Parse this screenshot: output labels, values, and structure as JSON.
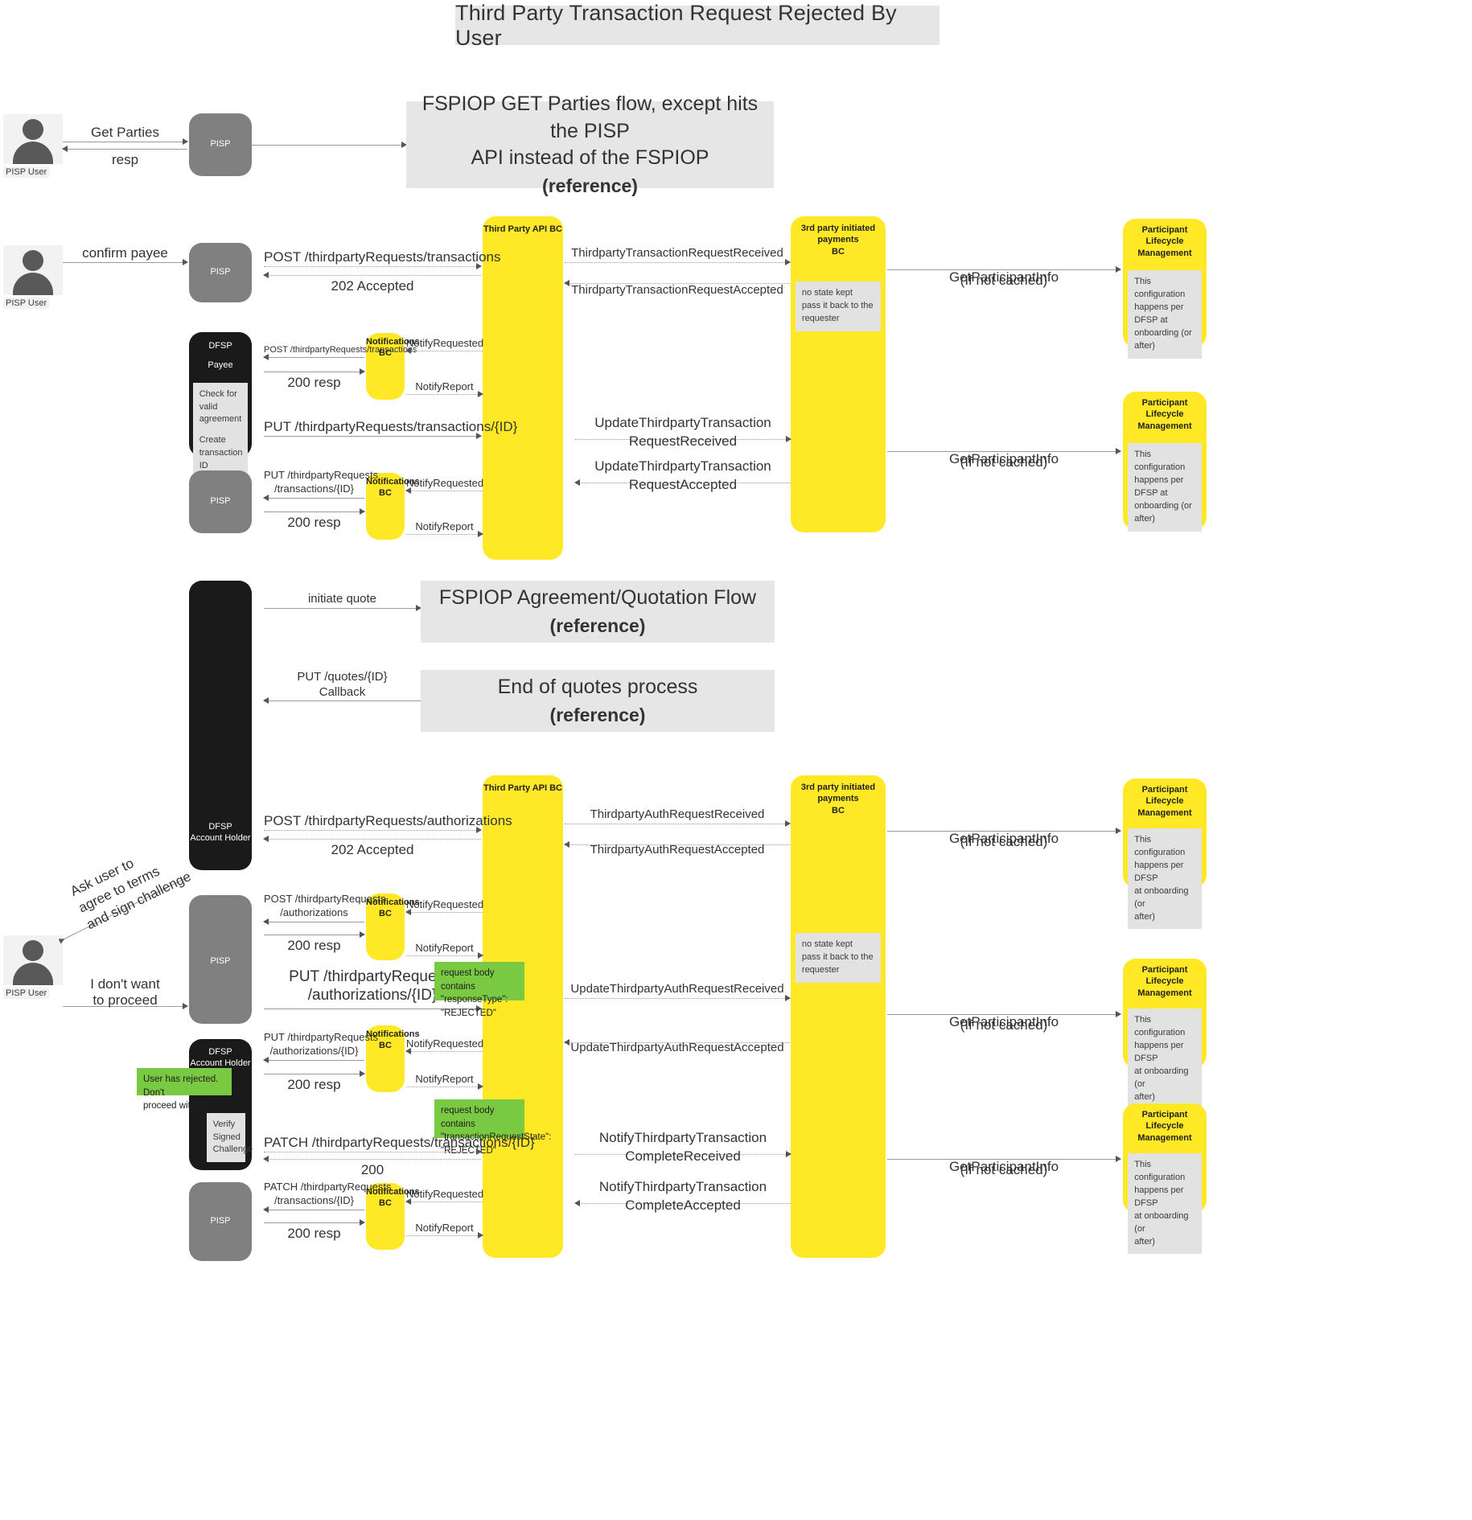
{
  "title": "Third Party Transaction Request Rejected By User",
  "actors": {
    "pisp_user": "PISP User",
    "pisp": "PISP",
    "dfsp_payee_line1": "DFSP",
    "dfsp_payee_line2": "Payee",
    "dfsp_account_holder_line1": "DFSP",
    "dfsp_account_holder_line2": "Account Holder",
    "third_party_api_bc": "Third Party API BC",
    "third_party_payments_bc": "3rd party initiated payments\nBC",
    "third_party_payments_bc_l1": "3rd party initiated payments",
    "third_party_payments_bc_l2": "BC",
    "notifications_bc_l1": "Notifications",
    "notifications_bc_l2": "BC",
    "participant_lifecycle_l1": "Participant Lifecycle",
    "participant_lifecycle_l2": "Management"
  },
  "reference_boxes": {
    "get_parties": {
      "main_line1": "FSPIOP GET Parties flow, except hits the PISP",
      "main_line2": "API instead of the FSPIOP",
      "sub": "(reference)"
    },
    "quotation": {
      "main_line1": "FSPIOP Agreement/Quotation Flow",
      "main_line2": "",
      "sub": "(reference)"
    },
    "end_of_quotes": {
      "main_line1": "End of quotes process",
      "main_line2": "",
      "sub": "(reference)"
    }
  },
  "notes": {
    "no_state_kept": "no state kept\npass it back to the\nrequester",
    "no_state_kept_l1": "no state kept",
    "no_state_kept_l2": "pass it back to the",
    "no_state_kept_l3": "requester",
    "config_onboarding_l1": "This configuration",
    "config_onboarding_l2": "happens per DFSP at",
    "config_onboarding_l3": "onboarding (or after)",
    "config_onboarding_b_l1": "This configuration",
    "config_onboarding_b_l2": "happens per DFSP",
    "config_onboarding_b_l3": "at onboarding (or",
    "config_onboarding_b_l4": "after)",
    "check_valid_agreement_l1": "Check for valid",
    "check_valid_agreement_l2": "agreement",
    "create_transaction_id_l1": "Create",
    "create_transaction_id_l2": "transaction ID",
    "verify_signed_challenge_l1": "Verify",
    "verify_signed_challenge_l2": "Signed",
    "verify_signed_challenge_l3": "Challenge",
    "green_response_type_l1": "request body contains",
    "green_response_type_l2": "\"responseType\":",
    "green_response_type_l3": "\"REJECTED\"",
    "green_tx_state_l1": "request body contains",
    "green_tx_state_l2": "\"transactionRequestState\":",
    "green_tx_state_l3": "\"REJECTED\"",
    "green_user_rejected_l1": "User has rejected. Don't",
    "green_user_rejected_l2": "proceed with tx."
  },
  "messages": {
    "get_parties": "Get Parties",
    "resp": "resp",
    "confirm_payee": "confirm payee",
    "post_tpr_transactions": "POST /thirdpartyRequests/transactions",
    "accepted_202": "202 Accepted",
    "tp_tx_req_received": "ThirdpartyTransactionRequestReceived",
    "tp_tx_req_accepted": "ThirdpartyTransactionRequestAccepted",
    "get_participant_info": "GetParticipantInfo",
    "if_not_cached": "(If not cached)",
    "post_tpr_transactions_small": "POST /thirdpartyRequests/transactions",
    "notify_requested": "NotifyRequested",
    "notify_report": "NotifyReport",
    "resp_200": "200 resp",
    "put_tpr_transactions_id": "PUT /thirdpartyRequests/transactions/{ID}",
    "put_tpr_transactions_l1": "PUT /thirdpartyRequests",
    "put_tpr_transactions_l2": "/transactions/{ID}",
    "update_tp_tx_req_received_l1": "UpdateThirdpartyTransaction",
    "update_tp_tx_req_received_l2": "RequestReceived",
    "update_tp_tx_req_accepted_l1": "UpdateThirdpartyTransaction",
    "update_tp_tx_req_accepted_l2": "RequestAccepted",
    "initiate_quote": "initiate quote",
    "put_quotes_l1": "PUT /quotes/{ID}",
    "put_quotes_l2": "Callback",
    "post_tpr_authorizations": "POST /thirdpartyRequests/authorizations",
    "tp_auth_req_received": "ThirdpartyAuthRequestReceived",
    "tp_auth_req_accepted": "ThirdpartyAuthRequestAccepted",
    "ask_user_l1": "Ask user to",
    "ask_user_l2": "agree to terms",
    "ask_user_l3": "and sign challenge",
    "dont_want_l1": "I don't want",
    "dont_want_l2": "to proceed",
    "post_tpr_auth_l1": "POST /thirdpartyRequests",
    "post_tpr_auth_l2": "/authorizations",
    "put_tpr_auth_id_l1": "PUT /thirdpartyRequests",
    "put_tpr_auth_id_l2": "/authorizations/{ID}",
    "update_tp_auth_req_received": "UpdateThirdpartyAuthRequestReceived",
    "update_tp_auth_req_accepted": "UpdateThirdpartyAuthRequestAccepted",
    "patch_tpr_transactions_id": "PATCH /thirdpartyRequests/transactions/{ID}",
    "patch_tpr_transactions_l1": "PATCH /thirdpartyRequests",
    "patch_tpr_transactions_l2": "/transactions/{ID}",
    "status_200": "200",
    "notify_tp_tx_complete_received_l1": "NotifyThirdpartyTransaction",
    "notify_tp_tx_complete_received_l2": "CompleteReceived",
    "notify_tp_tx_complete_accepted_l1": "NotifyThirdpartyTransaction",
    "notify_tp_tx_complete_accepted_l2": "CompleteAccepted"
  },
  "colors": {
    "yellow": "#ffe927",
    "gray_lane": "#808080",
    "black_lane": "#1a1a1a",
    "green_note": "#7ac943",
    "ref_box": "#e6e6e6",
    "note_gray": "#e2e2e2"
  }
}
